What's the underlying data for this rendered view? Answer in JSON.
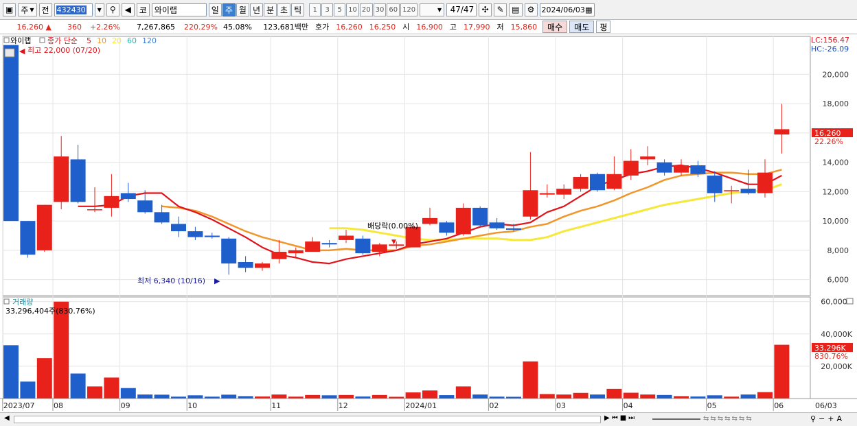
{
  "toolbar": {
    "mode_label": "주",
    "prev_label": "전",
    "code": "432430",
    "market_label": "코",
    "name": "와이랩",
    "periods": [
      "일",
      "주",
      "월",
      "년",
      "분",
      "초",
      "틱"
    ],
    "active_period": "주",
    "intervals": [
      "1",
      "3",
      "5",
      "10",
      "20",
      "30",
      "60",
      "120"
    ],
    "page_counter": "47/47",
    "date": "2024/06/03"
  },
  "quote": {
    "price": "16,260",
    "change_arrow": "▲",
    "change": "360",
    "change_pct": "+2.26%",
    "volume": "7,267,865",
    "volume_ratio": "220.29%",
    "turnover_pct": "45.08%",
    "amount": "123,681백만",
    "ask_label": "호가",
    "ask1": "16,260",
    "ask2": "16,250",
    "open_label": "시",
    "open": "16,900",
    "high_label": "고",
    "high": "17,990",
    "low_label": "저",
    "low": "15,860",
    "buy_label": "매수",
    "sell_label": "매도",
    "eval_label": "평"
  },
  "colors": {
    "up": "#e8221a",
    "down": "#1f5fcc",
    "ma5": "#e0121a",
    "ma10": "#f0962a",
    "ma20": "#f5e83a",
    "ma60": "#2bb5a8",
    "ma120": "#3f7fd0"
  },
  "price_panel": {
    "title": "와이랩",
    "indicator_label": "종가 단순",
    "ma_periods": [
      "5",
      "10",
      "20",
      "60",
      "120"
    ],
    "lc_label": "LC:156.47",
    "hc_label": "HC:-26.09",
    "max_label": "최고 22,000 (07/20)",
    "min_label": "최저 6,340 (10/16)",
    "dividend_label": "배당락(0.00%)",
    "current_price_tag": "16,260",
    "current_pct_tag": "22.26%",
    "y_ticks": [
      "20,000",
      "18,000",
      "16,000",
      "14,000",
      "12,000",
      "10,000",
      "8,000",
      "6,000"
    ]
  },
  "volume_panel": {
    "title": "거래량",
    "value_label": "33,296,404주(830.76%)",
    "current_tag": "33,296K",
    "current_pct_tag": "830.76%",
    "y_ticks": [
      "60,000K",
      "40,000K",
      "20,000K"
    ]
  },
  "x_axis": {
    "labels": [
      {
        "text": "2023/07",
        "week": 0
      },
      {
        "text": "08",
        "week": 3
      },
      {
        "text": "09",
        "week": 7
      },
      {
        "text": "10",
        "week": 11
      },
      {
        "text": "11",
        "week": 16
      },
      {
        "text": "12",
        "week": 20
      },
      {
        "text": "2024/01",
        "week": 24
      },
      {
        "text": "02",
        "week": 29
      },
      {
        "text": "03",
        "week": 33
      },
      {
        "text": "04",
        "week": 37
      },
      {
        "text": "05",
        "week": 42
      },
      {
        "text": "06",
        "week": 46
      }
    ],
    "end_label": "06/03"
  },
  "chart_data": {
    "type": "candlestick",
    "unit": "KRW (weekly)",
    "y_range": [
      5000,
      22500
    ],
    "volume_range": [
      0,
      62000
    ],
    "candles": [
      {
        "o": 22000,
        "h": 22000,
        "l": 10000,
        "c": 10000,
        "v": 33000
      },
      {
        "o": 10000,
        "h": 10000,
        "l": 7500,
        "c": 7700,
        "v": 10500
      },
      {
        "o": 8000,
        "h": 11100,
        "l": 7900,
        "c": 11100,
        "v": 25000
      },
      {
        "o": 11300,
        "h": 15800,
        "l": 10800,
        "c": 14400,
        "v": 60000
      },
      {
        "o": 14200,
        "h": 15200,
        "l": 11200,
        "c": 11300,
        "v": 15500
      },
      {
        "o": 10800,
        "h": 12300,
        "l": 10600,
        "c": 10800,
        "v": 7500
      },
      {
        "o": 10900,
        "h": 13200,
        "l": 10300,
        "c": 11700,
        "v": 13000
      },
      {
        "o": 11900,
        "h": 12600,
        "l": 11300,
        "c": 11500,
        "v": 6500
      },
      {
        "o": 11400,
        "h": 12100,
        "l": 10500,
        "c": 10600,
        "v": 2500
      },
      {
        "o": 10600,
        "h": 11100,
        "l": 9800,
        "c": 9900,
        "v": 2400
      },
      {
        "o": 9800,
        "h": 10300,
        "l": 8900,
        "c": 9300,
        "v": 1200
      },
      {
        "o": 9300,
        "h": 9600,
        "l": 8700,
        "c": 8900,
        "v": 2000
      },
      {
        "o": 9000,
        "h": 9200,
        "l": 8800,
        "c": 8900,
        "v": 1200
      },
      {
        "o": 8800,
        "h": 8900,
        "l": 6340,
        "c": 7100,
        "v": 2400
      },
      {
        "o": 7200,
        "h": 7600,
        "l": 6500,
        "c": 6800,
        "v": 1500
      },
      {
        "o": 6800,
        "h": 7200,
        "l": 6600,
        "c": 7100,
        "v": 1300
      },
      {
        "o": 7400,
        "h": 8700,
        "l": 7100,
        "c": 7900,
        "v": 2500
      },
      {
        "o": 7800,
        "h": 8200,
        "l": 7500,
        "c": 8000,
        "v": 1200
      },
      {
        "o": 7900,
        "h": 8900,
        "l": 7900,
        "c": 8600,
        "v": 2200
      },
      {
        "o": 8500,
        "h": 8700,
        "l": 8200,
        "c": 8400,
        "v": 2000
      },
      {
        "o": 8700,
        "h": 9400,
        "l": 8500,
        "c": 9000,
        "v": 2200
      },
      {
        "o": 8800,
        "h": 9000,
        "l": 7700,
        "c": 7800,
        "v": 1300
      },
      {
        "o": 7900,
        "h": 8500,
        "l": 7600,
        "c": 8400,
        "v": 2200
      },
      {
        "o": 8300,
        "h": 8600,
        "l": 8100,
        "c": 8400,
        "v": 1100
      },
      {
        "o": 8200,
        "h": 9900,
        "l": 8200,
        "c": 9600,
        "v": 3800
      },
      {
        "o": 9800,
        "h": 10900,
        "l": 9700,
        "c": 10200,
        "v": 5000
      },
      {
        "o": 9900,
        "h": 10000,
        "l": 9000,
        "c": 9200,
        "v": 2100
      },
      {
        "o": 9100,
        "h": 11200,
        "l": 9000,
        "c": 10900,
        "v": 7500
      },
      {
        "o": 10900,
        "h": 11000,
        "l": 9600,
        "c": 9700,
        "v": 2500
      },
      {
        "o": 9900,
        "h": 10200,
        "l": 9400,
        "c": 9500,
        "v": 1200
      },
      {
        "o": 9500,
        "h": 9800,
        "l": 9300,
        "c": 9400,
        "v": 1100
      },
      {
        "o": 10300,
        "h": 14700,
        "l": 10100,
        "c": 12100,
        "v": 23000
      },
      {
        "o": 11800,
        "h": 12500,
        "l": 11600,
        "c": 11900,
        "v": 2800
      },
      {
        "o": 11800,
        "h": 12500,
        "l": 11500,
        "c": 12200,
        "v": 2500
      },
      {
        "o": 12200,
        "h": 13200,
        "l": 12000,
        "c": 13000,
        "v": 3500
      },
      {
        "o": 13200,
        "h": 13300,
        "l": 12000,
        "c": 12100,
        "v": 2500
      },
      {
        "o": 12200,
        "h": 14400,
        "l": 12100,
        "c": 13200,
        "v": 6000
      },
      {
        "o": 13100,
        "h": 14900,
        "l": 12800,
        "c": 14100,
        "v": 3600
      },
      {
        "o": 14200,
        "h": 15100,
        "l": 13800,
        "c": 14400,
        "v": 2500
      },
      {
        "o": 14000,
        "h": 14200,
        "l": 13100,
        "c": 13300,
        "v": 2200
      },
      {
        "o": 13300,
        "h": 14200,
        "l": 13100,
        "c": 13800,
        "v": 1500
      },
      {
        "o": 13800,
        "h": 14100,
        "l": 13000,
        "c": 13200,
        "v": 1300
      },
      {
        "o": 13100,
        "h": 13400,
        "l": 11300,
        "c": 11900,
        "v": 2000
      },
      {
        "o": 12100,
        "h": 12400,
        "l": 11200,
        "c": 12100,
        "v": 1200
      },
      {
        "o": 12200,
        "h": 13500,
        "l": 11800,
        "c": 11900,
        "v": 2500
      },
      {
        "o": 11900,
        "h": 14200,
        "l": 11600,
        "c": 13300,
        "v": 4000
      },
      {
        "o": 15900,
        "h": 17990,
        "l": 14600,
        "c": 16260,
        "v": 33296
      }
    ],
    "ma5": [
      null,
      null,
      null,
      null,
      11000,
      11000,
      11100,
      11700,
      11900,
      11900,
      11000,
      10600,
      10100,
      9500,
      8900,
      8200,
      7700,
      7500,
      7200,
      7100,
      7400,
      7600,
      7800,
      8000,
      8400,
      8600,
      8800,
      9200,
      9600,
      9800,
      9700,
      9900,
      10600,
      11000,
      11700,
      12400,
      12800,
      13200,
      13400,
      13700,
      13800,
      13600,
      13300,
      12900,
      12500,
      12500,
      13100
    ],
    "ma10": [
      null,
      null,
      null,
      null,
      null,
      null,
      null,
      null,
      null,
      11000,
      10900,
      10700,
      10300,
      9800,
      9300,
      8900,
      8600,
      8300,
      8000,
      8000,
      8100,
      8000,
      8000,
      8000,
      8300,
      8400,
      8600,
      8800,
      9000,
      9200,
      9300,
      9600,
      9800,
      10300,
      10700,
      11000,
      11400,
      11900,
      12300,
      12800,
      13100,
      13200,
      13300,
      13300,
      13200,
      13200,
      13500
    ],
    "ma20": [
      null,
      null,
      null,
      null,
      null,
      null,
      null,
      null,
      null,
      null,
      null,
      null,
      null,
      null,
      null,
      null,
      null,
      null,
      null,
      9500,
      9500,
      9400,
      9200,
      9000,
      8800,
      8700,
      8700,
      8800,
      8800,
      8800,
      8700,
      8700,
      8900,
      9300,
      9600,
      9900,
      10200,
      10500,
      10800,
      11100,
      11300,
      11500,
      11700,
      11900,
      12000,
      12100,
      12500
    ]
  }
}
